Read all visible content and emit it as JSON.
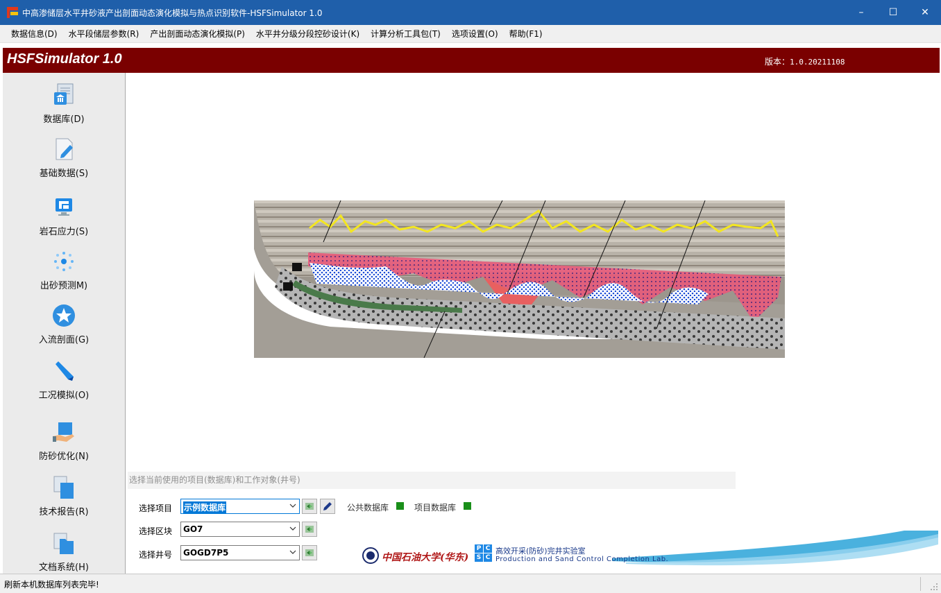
{
  "window": {
    "title": "中高渗储层水平井砂液产出剖面动态演化模拟与热点识别软件-HSFSimulator 1.0",
    "minimize_glyph": "–",
    "maximize_glyph": "☐",
    "close_glyph": "✕"
  },
  "menu": [
    {
      "label": "数据信息(D)"
    },
    {
      "label": "水平段储层参数(R)"
    },
    {
      "label": "产出剖面动态演化模拟(P)"
    },
    {
      "label": "水平井分级分段控砂设计(K)"
    },
    {
      "label": "计算分析工具包(T)"
    },
    {
      "label": "选项设置(O)"
    },
    {
      "label": "帮助(F1)"
    }
  ],
  "banner": {
    "app_name": "HSFSimulator 1.0",
    "version_label": "版本：",
    "version_value": "1.0.20211108",
    "color": "#7a0000"
  },
  "sidebar": {
    "items": [
      {
        "label": "数据库(D)",
        "icon": "database-icon"
      },
      {
        "label": "基础数据(S)",
        "icon": "edit-document-icon"
      },
      {
        "label": "岩石应力(S)",
        "icon": "monitor-icon"
      },
      {
        "label": "出砂预测M)",
        "icon": "dots-sand-icon"
      },
      {
        "label": "入流剖面(G)",
        "icon": "star-icon"
      },
      {
        "label": "工况模拟(O)",
        "icon": "pen-icon"
      },
      {
        "label": "防砂优化(N)",
        "icon": "hand-box-icon"
      },
      {
        "label": "技术报告(R)",
        "icon": "copy-documents-icon"
      },
      {
        "label": "文档系统(H)",
        "icon": "folder-documents-icon"
      }
    ]
  },
  "selector": {
    "caption": "选择当前使用的项目(数据库)和工作对象(井号)",
    "project_label": "选择项目",
    "project_value": "示例数据库",
    "block_label": "选择区块",
    "block_value": "GO7",
    "well_label": "选择井号",
    "well_value": "GOGD7P5",
    "public_db_label": "公共数据库",
    "project_db_label": "项目数据库",
    "status_color": "#1a8f1a"
  },
  "logo": {
    "university": "中国石油大学(华东)",
    "lab_cn": "高效开采(防砂)完井实验室",
    "lab_en": "Production and Sand Control Completion Lab.",
    "lab_letters": [
      "P",
      "C",
      "S",
      "C"
    ]
  },
  "status": {
    "message": "刷新本机数据库列表完毕!"
  }
}
